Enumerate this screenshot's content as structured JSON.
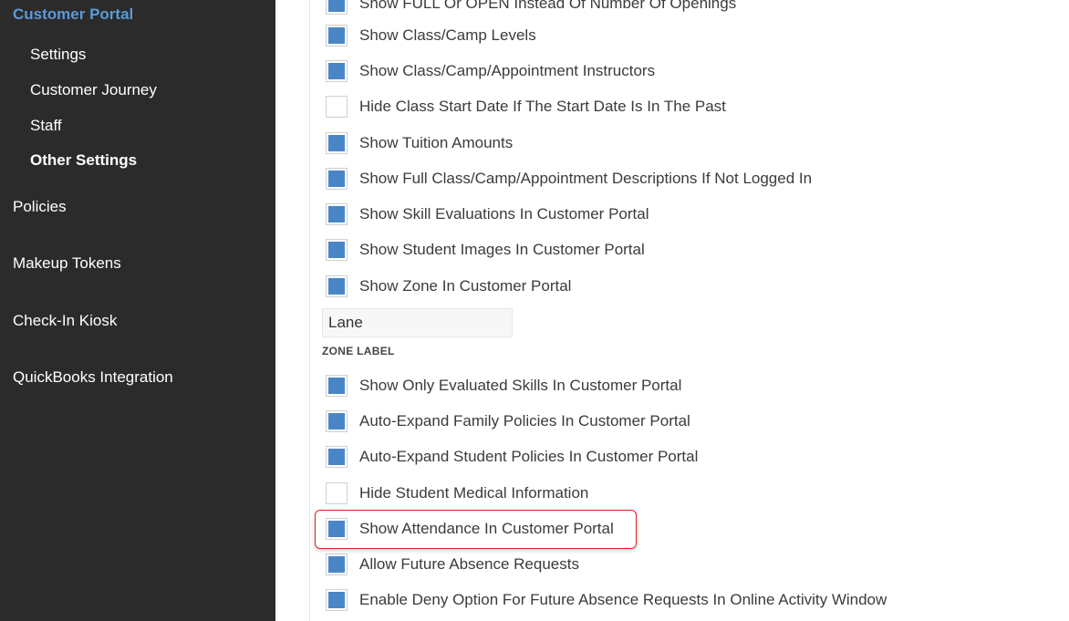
{
  "sidebar": {
    "section_title": "Customer Portal",
    "sub_items": [
      {
        "label": "Settings"
      },
      {
        "label": "Customer Journey"
      },
      {
        "label": "Staff"
      },
      {
        "label": "Other Settings",
        "active": true
      }
    ],
    "top_items": [
      {
        "label": "Policies"
      },
      {
        "label": "Makeup Tokens"
      },
      {
        "label": "Check-In Kiosk"
      },
      {
        "label": "QuickBooks Integration"
      }
    ]
  },
  "settings": [
    {
      "label": "Show FULL Or OPEN Instead Of Number Of Openings",
      "checked": true
    },
    {
      "label": "Show Class/Camp Levels",
      "checked": true
    },
    {
      "label": "Show Class/Camp/Appointment Instructors",
      "checked": true
    },
    {
      "label": "Hide Class Start Date If The Start Date Is In The Past",
      "checked": false
    },
    {
      "label": "Show Tuition Amounts",
      "checked": true
    },
    {
      "label": "Show Full Class/Camp/Appointment Descriptions If Not Logged In",
      "checked": true
    },
    {
      "label": "Show Skill Evaluations In Customer Portal",
      "checked": true
    },
    {
      "label": "Show Student Images In Customer Portal",
      "checked": true
    },
    {
      "label": "Show Zone In Customer Portal",
      "checked": true
    },
    {
      "label": "Show Only Evaluated Skills In Customer Portal",
      "checked": true
    },
    {
      "label": "Auto-Expand Family Policies In Customer Portal",
      "checked": true
    },
    {
      "label": "Auto-Expand Student Policies In Customer Portal",
      "checked": true
    },
    {
      "label": "Hide Student Medical Information",
      "checked": false
    },
    {
      "label": "Show Attendance In Customer Portal",
      "checked": true
    },
    {
      "label": "Allow Future Absence Requests",
      "checked": true
    },
    {
      "label": "Enable Deny Option For Future Absence Requests In Online Activity Window",
      "checked": true
    }
  ],
  "zone": {
    "value": "Lane",
    "label": "ZONE LABEL"
  },
  "colors": {
    "sidebar_bg": "#2b2b2b",
    "accent": "#5b9bd5",
    "checkbox_fill": "#4a86c5",
    "highlight": "#e02020"
  }
}
